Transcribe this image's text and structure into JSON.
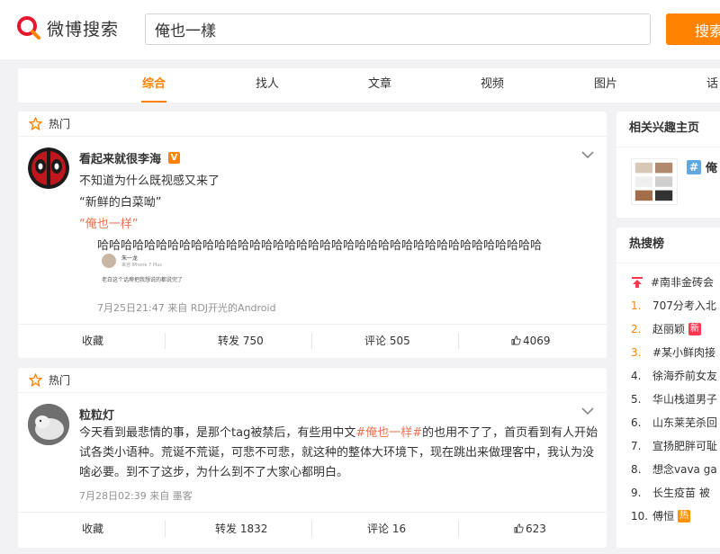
{
  "header": {
    "logo_text": "微博搜索",
    "search_value": "俺也一樣",
    "search_button": "搜索"
  },
  "tabs": [
    {
      "label": "综合",
      "active": true
    },
    {
      "label": "找人"
    },
    {
      "label": "文章"
    },
    {
      "label": "视频"
    },
    {
      "label": "图片"
    },
    {
      "label": "话"
    }
  ],
  "posts": [
    {
      "section": "热门",
      "user": "看起来就很李海",
      "verified_badge": "V",
      "lines": [
        "不知道为什么既视感又来了",
        "“新鲜的白菜呦”",
        "“俺也一样”",
        "哈哈哈哈哈哈哈哈哈哈哈哈哈哈哈哈哈哈哈哈哈哈哈哈哈哈哈哈哈哈哈哈哈哈哈哈哈哈"
      ],
      "embed": {
        "name": "朱一龙",
        "source": "来自 iPhone 7 Plus",
        "text": "老白这个话痨把我想说的都说完了"
      },
      "meta": "7月25日21:47 来自 RDJ开光的Android",
      "actions": {
        "favorite": "收藏",
        "repost": "转发 750",
        "comment": "评论 505",
        "like": "4069"
      }
    },
    {
      "section": "热门",
      "user": "粒粒灯",
      "text_before": "今天看到最悲情的事，是那个tag被禁后，有些用中文",
      "text_tag": "#俺也一样#",
      "text_after": "的也用不了了，首页看到有人开始试各类小语种。荒诞不荒诞，可悲不可悲，就这种的整体大环境下，现在跳出来做理客中，我认为没啥必要。到不了这步，为什么到不了大家心都明白。",
      "meta": "7月28日02:39 来自 墨客",
      "actions": {
        "favorite": "收藏",
        "repost": "转发 1832",
        "comment": "评论 16",
        "like": "623"
      }
    }
  ],
  "sidebar": {
    "related_title": "相关兴趣主页",
    "related_name": "俺",
    "hot_title": "热搜榜",
    "hot_items": [
      {
        "rank": "",
        "text": "#南非金砖会"
      },
      {
        "rank": "1.",
        "text": "707分考入北"
      },
      {
        "rank": "2.",
        "text": "赵丽颖",
        "tag": "新"
      },
      {
        "rank": "3.",
        "text": "#某小鲜肉接"
      },
      {
        "rank": "4.",
        "text": "徐海乔前女友"
      },
      {
        "rank": "5.",
        "text": "华山栈道男子"
      },
      {
        "rank": "6.",
        "text": "山东莱芜杀回"
      },
      {
        "rank": "7.",
        "text": "宣扬肥胖可耻"
      },
      {
        "rank": "8.",
        "text": "想念vava ga"
      },
      {
        "rank": "9.",
        "text": "长生疫苗 被"
      },
      {
        "rank": "10.",
        "text": "傅恒",
        "tag": "热"
      }
    ]
  },
  "colors": {
    "accent": "#ff8200",
    "highlight": "#eb7350",
    "meta": "#939393"
  }
}
